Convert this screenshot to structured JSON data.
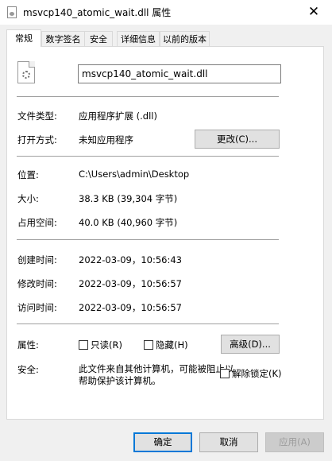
{
  "window": {
    "title": "msvcp140_atomic_wait.dll 属性",
    "close_glyph": "✕"
  },
  "tabs": [
    {
      "label": "常规"
    },
    {
      "label": "数字签名"
    },
    {
      "label": "安全"
    },
    {
      "label": "详细信息"
    },
    {
      "label": "以前的版本"
    }
  ],
  "file": {
    "name": "msvcp140_atomic_wait.dll"
  },
  "fields": {
    "type_label": "文件类型:",
    "type_value": "应用程序扩展 (.dll)",
    "open_label": "打开方式:",
    "open_value": "未知应用程序",
    "change_button": "更改(C)...",
    "location_label": "位置:",
    "location_value": "C:\\Users\\admin\\Desktop",
    "size_label": "大小:",
    "size_value": "38.3 KB (39,304 字节)",
    "disk_label": "占用空间:",
    "disk_value": "40.0 KB (40,960 字节)",
    "created_label": "创建时间:",
    "created_value": "2022-03-09，10:56:43",
    "modified_label": "修改时间:",
    "modified_value": "2022-03-09，10:56:57",
    "accessed_label": "访问时间:",
    "accessed_value": "2022-03-09，10:56:57",
    "attributes_label": "属性:",
    "readonly_label": "只读(R)",
    "hidden_label": "隐藏(H)",
    "advanced_button": "高级(D)...",
    "security_label": "安全:",
    "security_text": "此文件来自其他计算机，可能被阻止以帮助保护该计算机。",
    "unblock_label": "解除锁定(K)"
  },
  "buttons": {
    "ok": "确定",
    "cancel": "取消",
    "apply": "应用(A)"
  }
}
